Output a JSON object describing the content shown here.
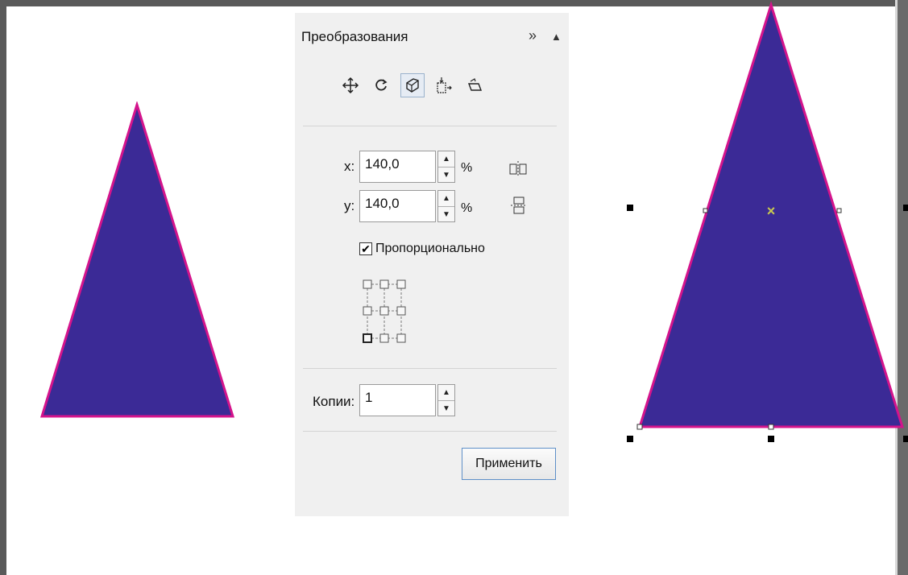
{
  "panel": {
    "title": "Преобразования",
    "collapse_glyph": "»",
    "menu_glyph": "▲",
    "toolbar": [
      {
        "name": "position-tool-icon",
        "active": false
      },
      {
        "name": "rotate-tool-icon",
        "active": false
      },
      {
        "name": "scale-mirror-tool-icon",
        "active": true
      },
      {
        "name": "size-tool-icon",
        "active": false
      },
      {
        "name": "skew-tool-icon",
        "active": false
      }
    ],
    "x_label": "x:",
    "x_value": "140,0",
    "y_label": "y:",
    "y_value": "140,0",
    "unit": "%",
    "proportional_label": "Пропорционально",
    "proportional_checked": "✔",
    "copies_label": "Копии:",
    "copies_value": "1",
    "apply_label": "Применить"
  },
  "colors": {
    "triangle_fill": "#3b2a96",
    "triangle_stroke": "#d4148c",
    "center_marker": "#c8c850"
  }
}
